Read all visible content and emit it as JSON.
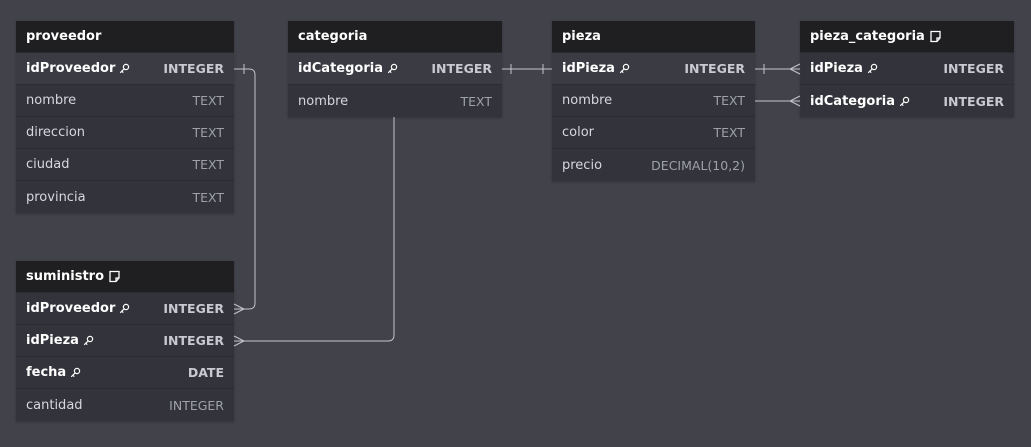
{
  "colors": {
    "canvas": "#41424a",
    "table_body": "#33343b",
    "table_header": "#1f1f22",
    "connector": "#c5c6cc"
  },
  "tables": {
    "proveedor": {
      "name": "proveedor",
      "has_note": false,
      "columns": [
        {
          "name": "idProveedor",
          "type": "INTEGER",
          "key": true,
          "pk": true
        },
        {
          "name": "nombre",
          "type": "TEXT",
          "key": false,
          "pk": false
        },
        {
          "name": "direccion",
          "type": "TEXT",
          "key": false,
          "pk": false
        },
        {
          "name": "ciudad",
          "type": "TEXT",
          "key": false,
          "pk": false
        },
        {
          "name": "provincia",
          "type": "TEXT",
          "key": false,
          "pk": false
        }
      ]
    },
    "categoria": {
      "name": "categoria",
      "has_note": false,
      "columns": [
        {
          "name": "idCategoria",
          "type": "INTEGER",
          "key": true,
          "pk": true
        },
        {
          "name": "nombre",
          "type": "TEXT",
          "key": false,
          "pk": false
        }
      ]
    },
    "pieza": {
      "name": "pieza",
      "has_note": false,
      "columns": [
        {
          "name": "idPieza",
          "type": "INTEGER",
          "key": true,
          "pk": true
        },
        {
          "name": "nombre",
          "type": "TEXT",
          "key": false,
          "pk": false
        },
        {
          "name": "color",
          "type": "TEXT",
          "key": false,
          "pk": false
        },
        {
          "name": "precio",
          "type": "DECIMAL(10,2)",
          "key": false,
          "pk": false
        }
      ]
    },
    "pieza_categoria": {
      "name": "pieza_categoria",
      "has_note": true,
      "columns": [
        {
          "name": "idPieza",
          "type": "INTEGER",
          "key": true,
          "pk": false
        },
        {
          "name": "idCategoria",
          "type": "INTEGER",
          "key": true,
          "pk": false
        }
      ]
    },
    "suministro": {
      "name": "suministro",
      "has_note": true,
      "columns": [
        {
          "name": "idProveedor",
          "type": "INTEGER",
          "key": true,
          "pk": false
        },
        {
          "name": "idPieza",
          "type": "INTEGER",
          "key": true,
          "pk": false
        },
        {
          "name": "fecha",
          "type": "DATE",
          "key": true,
          "pk": false
        },
        {
          "name": "cantidad",
          "type": "INTEGER",
          "key": false,
          "pk": false
        }
      ]
    }
  },
  "relationships": [
    {
      "from": "proveedor.idProveedor",
      "to": "suministro.idProveedor",
      "from_card": "one",
      "to_card": "many"
    },
    {
      "from": "categoria.idCategoria",
      "to": "pieza.idPieza",
      "from_card": "one",
      "to_card": "one"
    },
    {
      "from": "categoria.idCategoria",
      "to": "suministro.idPieza",
      "from_card": "one",
      "to_card": "many"
    },
    {
      "from": "pieza.idPieza",
      "to": "pieza_categoria.idPieza",
      "from_card": "one",
      "to_card": "many"
    },
    {
      "from": "pieza.nombre",
      "to": "pieza_categoria.idCategoria",
      "from_card": "none",
      "to_card": "many"
    }
  ]
}
